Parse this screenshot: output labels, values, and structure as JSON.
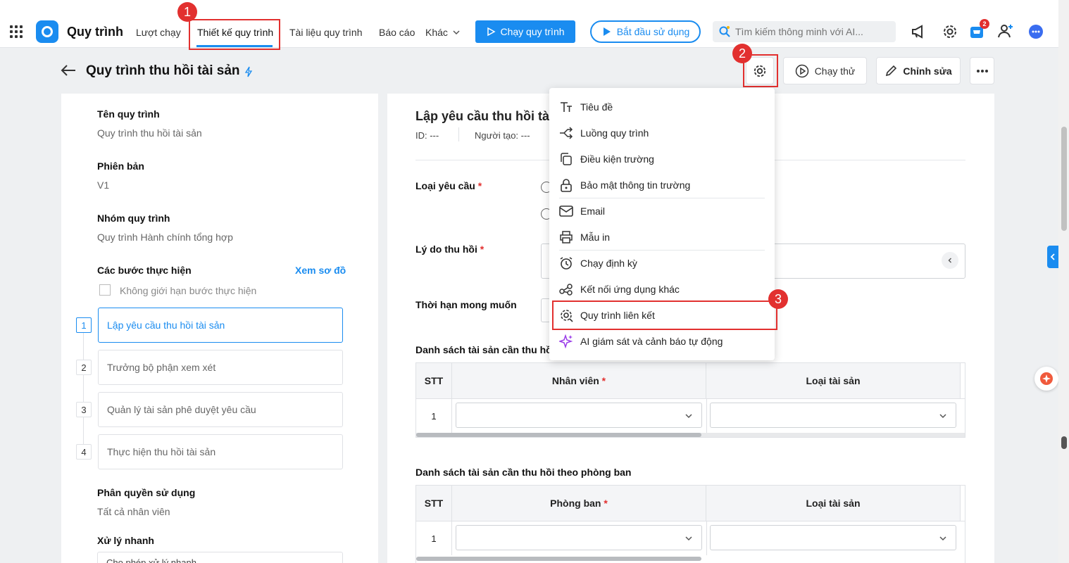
{
  "header": {
    "app_name": "Quy trình",
    "nav": [
      "Lượt chạy",
      "Thiết kế quy trình",
      "Tài liệu quy trình",
      "Báo cáo",
      "Khác"
    ],
    "run_button": "Chạy quy trình",
    "start_button": "Bắt đầu sử dụng",
    "search_placeholder": "Tìm kiếm thông minh với AI...",
    "cart_badge": "2"
  },
  "annotations": [
    "1",
    "2",
    "3"
  ],
  "page": {
    "title": "Quy trình thu hồi tài sản",
    "test_run": "Chạy thử",
    "edit": "Chỉnh sửa"
  },
  "left": {
    "name_label": "Tên quy trình",
    "name_value": "Quy trình thu hồi tài sản",
    "version_label": "Phiên bản",
    "version_value": "V1",
    "group_label": "Nhóm quy trình",
    "group_value": "Quy trình Hành chính tổng hợp",
    "steps_label": "Các bước thực hiện",
    "view_diagram": "Xem sơ đồ",
    "unlimited": "Không giới hạn bước thực hiện",
    "steps": [
      {
        "num": "1",
        "name": "Lập yêu cầu thu hồi tài sản"
      },
      {
        "num": "2",
        "name": "Trưởng bộ phận xem xét"
      },
      {
        "num": "3",
        "name": "Quản lý tài sản phê duyệt yêu cầu"
      },
      {
        "num": "4",
        "name": "Thực hiện thu hồi tài sản"
      }
    ],
    "perm_label": "Phân quyền sử dụng",
    "perm_value": "Tất cả nhân viên",
    "quick_label": "Xử lý nhanh",
    "quick_value": "Cho phép xử lý nhanh..."
  },
  "form": {
    "title": "Lập yêu cầu thu hồi tài s",
    "id_label": "ID: ---",
    "creator_label": "Người tạo: ---",
    "type_label": "Loại yêu cầu",
    "reason_label": "Lý do thu hồi",
    "deadline_label": "Thời hạn mong muốn",
    "list1_title": "Danh sách tài sản cần thu hồi t",
    "list2_title": "Danh sách tài sản cần thu hồi theo phòng ban",
    "col_stt": "STT",
    "col_employee": "Nhân viên",
    "col_asset_type": "Loại tài sản",
    "col_department": "Phòng ban",
    "row1": "1",
    "required_mark": "*"
  },
  "menu": {
    "items": [
      "Tiêu đề",
      "Luồng quy trình",
      "Điều kiện trường",
      "Bảo mật thông tin trường",
      "Email",
      "Mẫu in",
      "Chạy định kỳ",
      "Kết nối ứng dụng khác",
      "Quy trình liên kết",
      "AI giám sát và cảnh báo tự động"
    ]
  },
  "colors": {
    "accent": "#1a8cf0",
    "annotation_red": "#e2302f"
  }
}
